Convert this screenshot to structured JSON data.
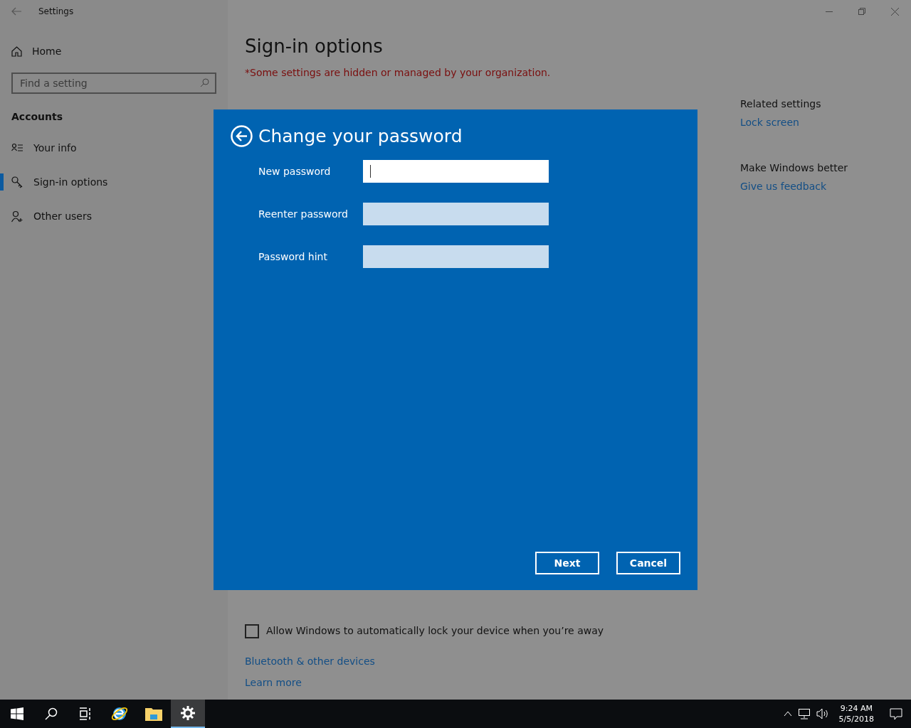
{
  "window": {
    "title": "Settings"
  },
  "sidebar": {
    "home": "Home",
    "search": {
      "placeholder": "Find a setting"
    },
    "section": "Accounts",
    "items": [
      {
        "label": "Your info",
        "kind": "info",
        "selected": false
      },
      {
        "label": "Sign-in options",
        "kind": "key",
        "selected": true
      },
      {
        "label": "Other users",
        "kind": "users",
        "selected": false
      }
    ]
  },
  "content": {
    "title": "Sign-in options",
    "notice": "*Some settings are hidden or managed by your organization.",
    "checkbox": {
      "label": "Allow Windows to automatically lock your device when you’re away",
      "checked": false
    },
    "links": [
      "Bluetooth & other devices",
      "Learn more"
    ]
  },
  "related": [
    {
      "heading": "Related settings",
      "link": "Lock screen"
    },
    {
      "heading": "Make Windows better",
      "link": "Give us feedback"
    }
  ],
  "dialog": {
    "title": "Change your password",
    "fields": [
      {
        "label": "New password",
        "focused": true
      },
      {
        "label": "Reenter password",
        "focused": false
      },
      {
        "label": "Password hint",
        "focused": false
      }
    ],
    "buttons": [
      "Next",
      "Cancel"
    ]
  },
  "taskbar": {
    "apps": [
      {
        "kind": "start",
        "selected": false
      },
      {
        "kind": "search",
        "selected": false
      },
      {
        "kind": "taskview",
        "selected": false
      },
      {
        "kind": "browser",
        "selected": false
      },
      {
        "kind": "folder",
        "selected": false
      },
      {
        "kind": "settings",
        "selected": true
      }
    ],
    "time": "9:24 AM",
    "date": "5/5/2018"
  }
}
